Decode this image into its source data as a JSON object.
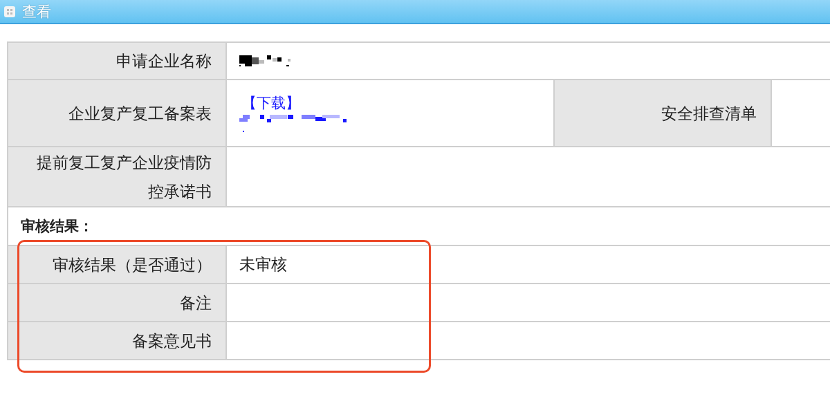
{
  "window": {
    "title": "查看"
  },
  "rows": [
    {
      "kind": "field",
      "label": "申请企业名称",
      "value": {
        "kind": "redacted"
      }
    },
    {
      "kind": "field_pair",
      "label": "企业复产复工备案表",
      "value": {
        "kind": "download",
        "link": "【下载】"
      },
      "label_2": "安全排查清单"
    },
    {
      "kind": "field",
      "label": "提前复工复产企业疫情防控承诺书"
    },
    {
      "kind": "section",
      "label": "审核结果："
    },
    {
      "kind": "field",
      "label": "审核结果（是否通过）",
      "value": {
        "kind": "text",
        "text": "未审核"
      }
    },
    {
      "kind": "field",
      "label": "备注"
    },
    {
      "kind": "field",
      "label": "备案意见书"
    }
  ],
  "annotation": {
    "kind": "highlight_box"
  }
}
